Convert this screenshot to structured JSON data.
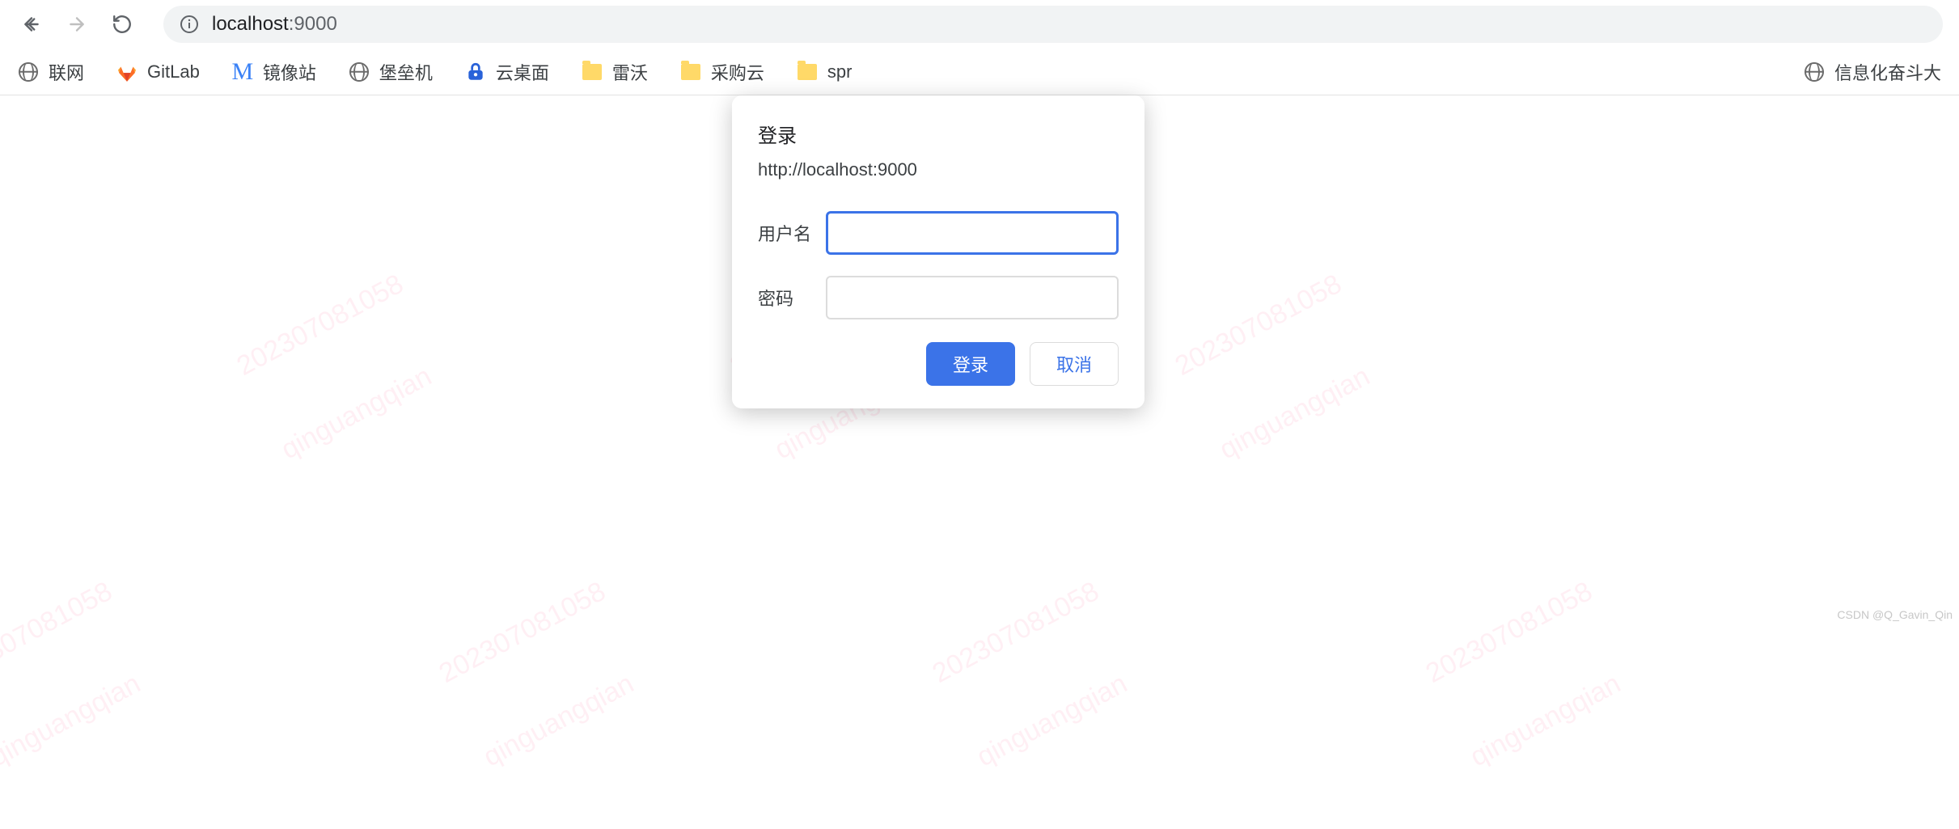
{
  "toolbar": {
    "url_host": "localhost",
    "url_port": ":9000"
  },
  "bookmarks": {
    "items": [
      {
        "label": "联网",
        "icon": "globe-icon"
      },
      {
        "label": "GitLab",
        "icon": "gitlab-icon"
      },
      {
        "label": "镜像站",
        "icon": "m-icon"
      },
      {
        "label": "堡垒机",
        "icon": "globe-icon"
      },
      {
        "label": "云桌面",
        "icon": "lock-icon"
      },
      {
        "label": "雷沃",
        "icon": "folder-icon"
      },
      {
        "label": "采购云",
        "icon": "folder-icon"
      },
      {
        "label": "spr",
        "icon": "folder-icon"
      }
    ],
    "right_item": {
      "label": "信息化奋斗大",
      "icon": "globe-icon"
    }
  },
  "auth_dialog": {
    "title": "登录",
    "origin": "http://localhost:9000",
    "username_label": "用户名",
    "password_label": "密码",
    "username_value": "",
    "password_value": "",
    "submit_label": "登录",
    "cancel_label": "取消"
  },
  "watermark": {
    "line1": "202307081058",
    "line2": "qinguangqian"
  },
  "footer": {
    "credit": "CSDN @Q_Gavin_Qin"
  }
}
